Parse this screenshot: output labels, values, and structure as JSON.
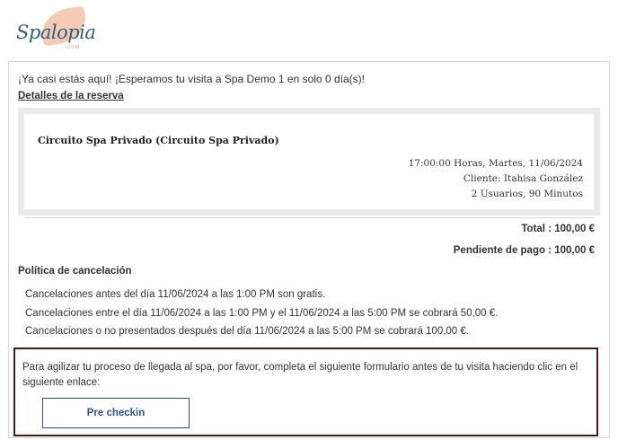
{
  "logo": {
    "brand": "Spalopia",
    "suffix": ".COM"
  },
  "message": {
    "greeting": "¡Ya casi estás aquí! ¡Esperamos tu visita a Spa Demo 1 en solo 0 día(s)!",
    "details_title": "Detalles de la reserva"
  },
  "booking": {
    "service": "Circuito Spa Privado (Circuito Spa Privado)",
    "datetime": "17:00:00 Horas, Martes, 11/06/2024",
    "client": "Cliente: Itahisa González",
    "users_duration": "2 Usuarios, 90 Minutos"
  },
  "totals": {
    "total": "Total : 100,00 €",
    "pending": "Pendiente de pago : 100,00 €"
  },
  "policy": {
    "title": "Política de cancelación",
    "items": [
      "Cancelaciones antes del día 11/06/2024 a las 1:00 PM son gratis.",
      "Cancelaciones entre el día 11/06/2024 a las 1:00 PM y el 11/06/2024 a las 5:00 PM se cobrará 50,00 €.",
      "Cancelaciones o no presentados después del día 11/06/2024 a las 5:00 PM se cobrará 100,00 €."
    ]
  },
  "checkin": {
    "text": "Para agilizar tu proceso de llegada al spa, por favor, completa el siguiente formulario antes de tu visita haciendo clic en el siguiente enlace:",
    "button_label": "Pre checkin"
  },
  "colors": {
    "brand": "#2f5f78",
    "accent_leaf": "#f3c2a8",
    "checkin_border": "#4a1c14",
    "button": "#2f4fa0"
  }
}
